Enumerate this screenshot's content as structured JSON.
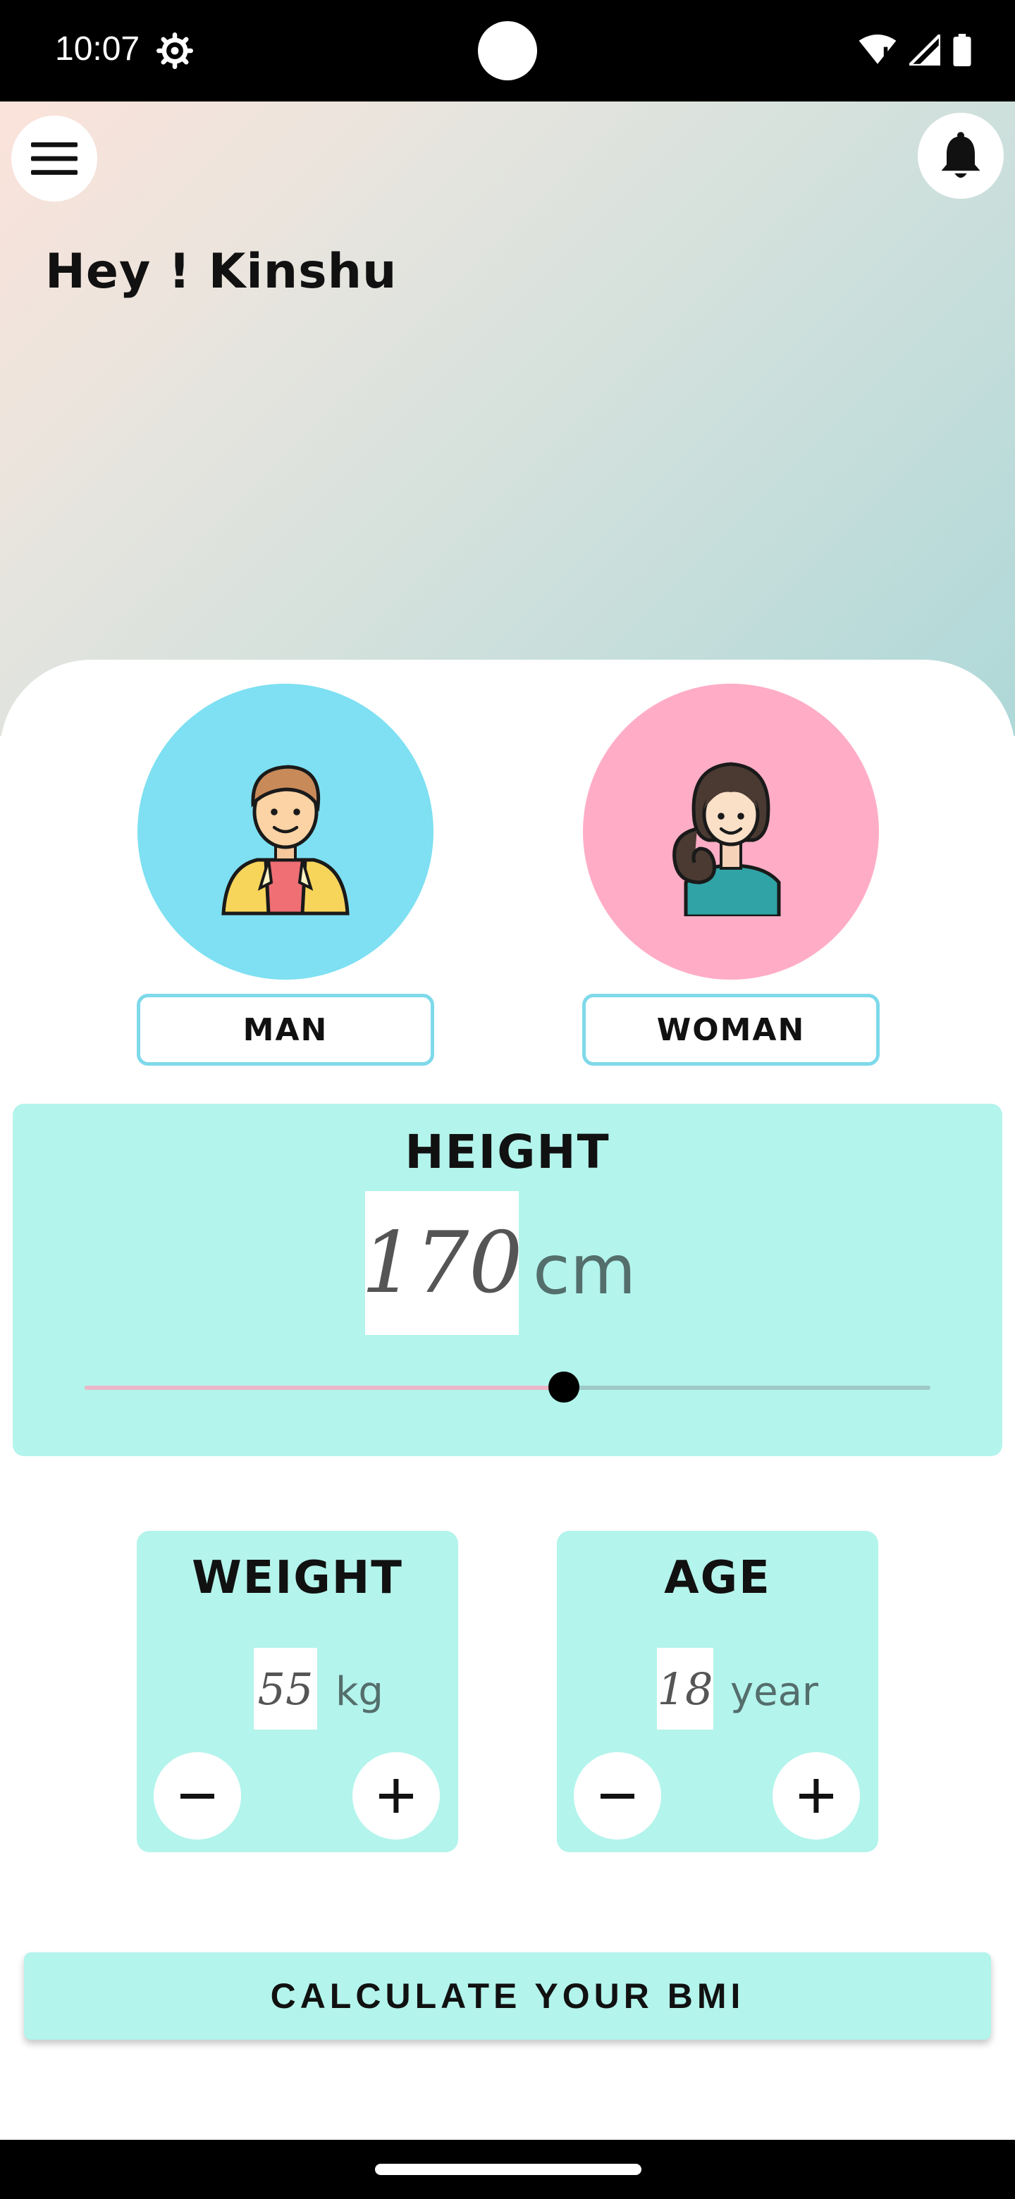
{
  "status_bar": {
    "time": "10:07",
    "icons": [
      "settings-gear-icon",
      "wifi-icon",
      "signal-icon",
      "battery-icon"
    ]
  },
  "header": {
    "greeting": "Hey ! Kinshu",
    "menu_icon": "hamburger-menu-icon",
    "notification_icon": "bell-icon"
  },
  "gender": {
    "options": [
      {
        "label": "MAN",
        "icon": "man-avatar-icon",
        "color": "#7ee0f2"
      },
      {
        "label": "WOMAN",
        "icon": "woman-avatar-icon",
        "color": "#ffadc6"
      }
    ]
  },
  "height": {
    "title": "HEIGHT",
    "value": "170",
    "unit": "cm",
    "slider_fraction": 0.567
  },
  "weight": {
    "title": "WEIGHT",
    "value": "55",
    "unit": "kg"
  },
  "age": {
    "title": "AGE",
    "value": "18",
    "unit": "year"
  },
  "calculate_button": {
    "label": "CALCULATE YOUR BMI"
  },
  "colors": {
    "card_bg": "#b3f4ec",
    "accent_border": "#7ed9ea",
    "slider_fill": "#ecb6c8"
  }
}
